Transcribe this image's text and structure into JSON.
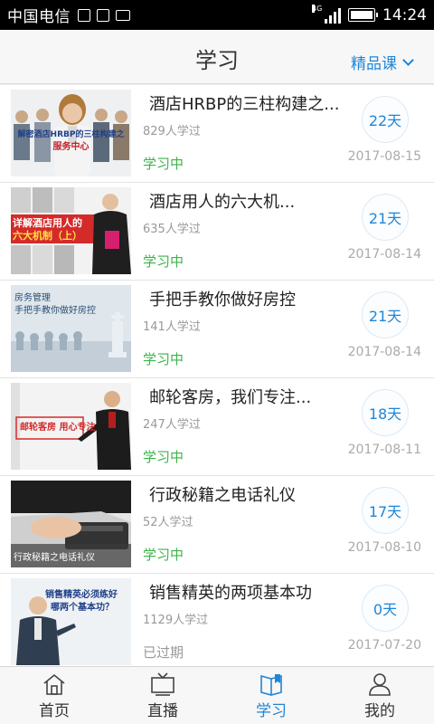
{
  "status_bar": {
    "carrier": "中国电信",
    "network": "4G",
    "time": "14:24"
  },
  "header": {
    "title": "学习",
    "filter_label": "精品课"
  },
  "courses": [
    {
      "title": "酒店HRBP的三柱构建之...",
      "learners": "829人学过",
      "status": "学习中",
      "days": "22天",
      "date": "2017-08-15",
      "thumb_text": [
        "解密酒店HRBP的三柱构建之",
        "服务中心"
      ]
    },
    {
      "title": "酒店用人的六大机...",
      "learners": "635人学过",
      "status": "学习中",
      "days": "21天",
      "date": "2017-08-14",
      "thumb_text": [
        "详解酒店用人的",
        "六大机制（上）"
      ]
    },
    {
      "title": "手把手教你做好房控",
      "learners": "141人学过",
      "status": "学习中",
      "days": "21天",
      "date": "2017-08-14",
      "thumb_text": [
        "房务管理",
        "手把手教你做好房控"
      ]
    },
    {
      "title": "邮轮客房，我们专注...",
      "learners": "247人学过",
      "status": "学习中",
      "days": "18天",
      "date": "2017-08-11",
      "thumb_text": [
        "邮轮客房 用心专注"
      ]
    },
    {
      "title": "行政秘籍之电话礼仪",
      "learners": "52人学过",
      "status": "学习中",
      "days": "17天",
      "date": "2017-08-10",
      "thumb_text": [
        "行政秘籍之电话礼仪"
      ]
    },
    {
      "title": "销售精英的两项基本功",
      "learners": "1129人学过",
      "status": "已过期",
      "days": "0天",
      "date": "2017-07-20",
      "thumb_text": [
        "销售精英必须练好",
        "哪两个基本功？"
      ]
    }
  ],
  "tabs": [
    {
      "label": "首页",
      "icon": "home-icon"
    },
    {
      "label": "直播",
      "icon": "tv-icon"
    },
    {
      "label": "学习",
      "icon": "book-icon"
    },
    {
      "label": "我的",
      "icon": "user-icon"
    }
  ],
  "active_tab": 2,
  "colors": {
    "accent": "#1f86d6",
    "status_active": "#3cb34a",
    "status_expired": "#999999",
    "thumb_red": "#d42a2a"
  }
}
